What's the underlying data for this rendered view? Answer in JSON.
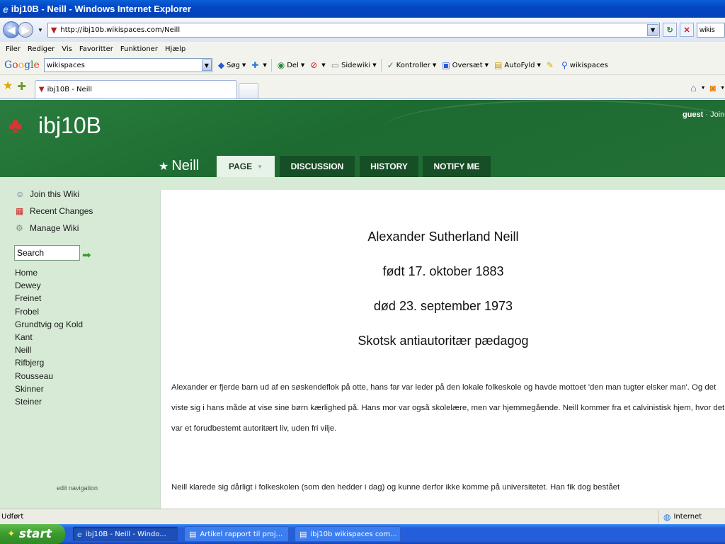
{
  "window": {
    "title": "ibj10B - Neill - Windows Internet Explorer"
  },
  "address": {
    "url": "http://ibj10b.wikispaces.com/Neill",
    "search_value": "wikis"
  },
  "menubar": [
    "Filer",
    "Rediger",
    "Vis",
    "Favoritter",
    "Funktioner",
    "Hjælp"
  ],
  "google_toolbar": {
    "logo_letters": [
      "G",
      "o",
      "o",
      "g",
      "l",
      "e"
    ],
    "search_value": "wikispaces",
    "items": [
      {
        "icon": "search-icon",
        "label": "Søg"
      },
      {
        "icon": "plus-icon",
        "label": ""
      },
      {
        "icon": "share-icon",
        "label": "Del"
      },
      {
        "icon": "block-icon",
        "label": ""
      },
      {
        "icon": "sidewiki-icon",
        "label": "Sidewiki"
      },
      {
        "icon": "spellcheck-icon",
        "label": "Kontroller"
      },
      {
        "icon": "translate-icon",
        "label": "Oversæt"
      },
      {
        "icon": "autofill-icon",
        "label": "AutoFyld"
      },
      {
        "icon": "pencil-icon",
        "label": ""
      },
      {
        "icon": "magnifier-icon",
        "label": "wikispaces"
      }
    ]
  },
  "browser_tab": {
    "label": "ibj10B - Neill"
  },
  "site": {
    "title": "ibj10B",
    "user": "guest",
    "join_link": "· Join",
    "page_name": "Neill",
    "tabs": [
      {
        "label": "PAGE"
      },
      {
        "label": "DISCUSSION"
      },
      {
        "label": "HISTORY"
      },
      {
        "label": "NOTIFY ME"
      }
    ]
  },
  "sidebar": {
    "actions": [
      {
        "label": "Join this Wiki",
        "icon": "user-icon"
      },
      {
        "label": "Recent Changes",
        "icon": "calendar-icon"
      },
      {
        "label": "Manage Wiki",
        "icon": "gear-icon"
      }
    ],
    "search_placeholder": "Search",
    "nav": [
      "Home",
      "Dewey",
      "Freinet",
      "Frobel",
      "Grundtvig og Kold",
      "Kant",
      "Neill",
      "Rifbjerg",
      "Rousseau",
      "Skinner",
      "Steiner"
    ],
    "edit_nav": "edit navigation"
  },
  "content": {
    "headings": [
      "Alexander Sutherland Neill",
      "født 17. oktober 1883",
      "død 23. september 1973",
      "Skotsk antiautoritær pædagog"
    ],
    "paragraph1": "Alexander er fjerde barn ud af en søskendeflok på otte, hans far var leder på den lokale folkeskole og havde mottoet 'den man tugter elsker man'.  Og det viste sig i hans måde at vise sine børn kærlighed på. Hans mor var også skolelære, men var hjemmegående.  Neill kommer fra et calvinistisk hjem, hvor det var et forudbestemt autoritært liv, uden fri vilje.",
    "paragraph2": "Neill klarede sig dårligt i folkeskolen (som den hedder i dag) og kunne derfor ikke komme på universitetet. Han fik dog bestået"
  },
  "statusbar": {
    "text": "Udført",
    "zone": "Internet"
  },
  "taskbar": {
    "start": "start",
    "tasks": [
      {
        "label": "ibj10B - Neill - Windo...",
        "icon": "ie-icon"
      },
      {
        "label": "Artikel rapport til proj...",
        "icon": "word-icon"
      },
      {
        "label": "ibj10b wikispaces com...",
        "icon": "word-icon"
      }
    ]
  }
}
